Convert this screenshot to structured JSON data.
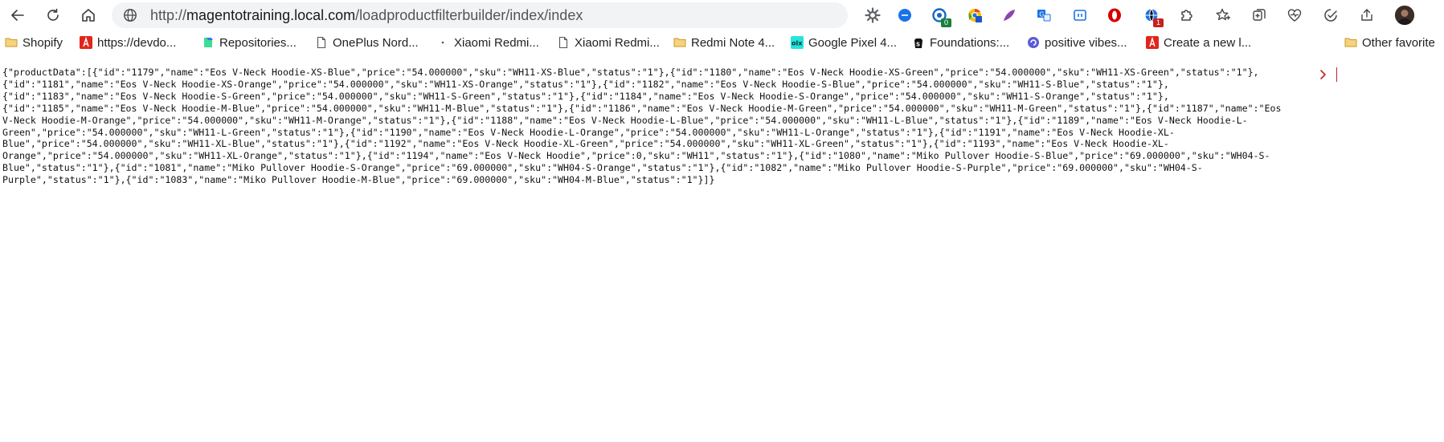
{
  "browser": {
    "url_scheme": "http://",
    "url_domain": "magentotraining.local.com",
    "url_path": "/loadproductfilterbuilder/index/index",
    "extensions": [
      {
        "name": "gear-extension-icon",
        "color": "#5f6368"
      },
      {
        "name": "blue-circle-extension-icon",
        "color": "#1a73e8"
      },
      {
        "name": "shield-extension-icon",
        "color": "#1565c0",
        "badge": "0",
        "badge_color": "#188038"
      },
      {
        "name": "chrome-extension-icon",
        "color": "#ea4335"
      },
      {
        "name": "feather-extension-icon",
        "color": "#8e44ad"
      },
      {
        "name": "translate-extension-icon",
        "color": "#1a73e8"
      },
      {
        "name": "bracket-extension-icon",
        "color": "#1a73e8"
      },
      {
        "name": "opera-extension-icon",
        "color": "#d50000"
      },
      {
        "name": "globe-extension-icon",
        "color": "#1a73e8",
        "badge": "1",
        "badge_color": "#c5221f"
      },
      {
        "name": "puzzle-extension-icon",
        "color": "#444"
      },
      {
        "name": "favorites-star-icon",
        "color": "#444"
      },
      {
        "name": "collections-icon",
        "color": "#444"
      },
      {
        "name": "heart-pulse-icon",
        "color": "#444"
      },
      {
        "name": "performance-icon",
        "color": "#444"
      },
      {
        "name": "share-icon",
        "color": "#444"
      }
    ]
  },
  "bookmarks": {
    "items": [
      {
        "label": "Shopify",
        "icon": "folder-icon"
      },
      {
        "label": "https://devdo...",
        "icon": "adobe-icon"
      },
      {
        "label": "Repositories...",
        "icon": "repo-icon"
      },
      {
        "label": "OnePlus Nord...",
        "icon": "page-icon"
      },
      {
        "label": "Xiaomi Redmi...",
        "icon": "dot-icon"
      },
      {
        "label": "Xiaomi Redmi...",
        "icon": "page-icon"
      },
      {
        "label": "Redmi Note 4...",
        "icon": "folder-icon"
      },
      {
        "label": "Google Pixel 4...",
        "icon": "olx-icon"
      },
      {
        "label": "Foundations:...",
        "icon": "shopify-icon"
      },
      {
        "label": "positive vibes...",
        "icon": "vibes-icon"
      },
      {
        "label": "Create a new l...",
        "icon": "adobe-icon"
      }
    ],
    "other_label": "Other favorite"
  },
  "page": {
    "lines": [
      "{\"productData\":[{\"id\":\"1179\",\"name\":\"Eos V-Neck Hoodie-XS-Blue\",\"price\":\"54.000000\",\"sku\":\"WH11-XS-Blue\",\"status\":\"1\"},{\"id\":\"1180\",\"name\":\"Eos V-Neck Hoodie-XS-Green\",\"price\":\"54.000000\",\"sku\":\"WH11-XS-Green\",\"status\":\"1\"},",
      "{\"id\":\"1181\",\"name\":\"Eos V-Neck Hoodie-XS-Orange\",\"price\":\"54.000000\",\"sku\":\"WH11-XS-Orange\",\"status\":\"1\"},{\"id\":\"1182\",\"name\":\"Eos V-Neck Hoodie-S-Blue\",\"price\":\"54.000000\",\"sku\":\"WH11-S-Blue\",\"status\":\"1\"},",
      "{\"id\":\"1183\",\"name\":\"Eos V-Neck Hoodie-S-Green\",\"price\":\"54.000000\",\"sku\":\"WH11-S-Green\",\"status\":\"1\"},{\"id\":\"1184\",\"name\":\"Eos V-Neck Hoodie-S-Orange\",\"price\":\"54.000000\",\"sku\":\"WH11-S-Orange\",\"status\":\"1\"},",
      "{\"id\":\"1185\",\"name\":\"Eos V-Neck Hoodie-M-Blue\",\"price\":\"54.000000\",\"sku\":\"WH11-M-Blue\",\"status\":\"1\"},{\"id\":\"1186\",\"name\":\"Eos V-Neck Hoodie-M-Green\",\"price\":\"54.000000\",\"sku\":\"WH11-M-Green\",\"status\":\"1\"},{\"id\":\"1187\",\"name\":\"Eos",
      "V-Neck Hoodie-M-Orange\",\"price\":\"54.000000\",\"sku\":\"WH11-M-Orange\",\"status\":\"1\"},{\"id\":\"1188\",\"name\":\"Eos V-Neck Hoodie-L-Blue\",\"price\":\"54.000000\",\"sku\":\"WH11-L-Blue\",\"status\":\"1\"},{\"id\":\"1189\",\"name\":\"Eos V-Neck Hoodie-L-",
      "Green\",\"price\":\"54.000000\",\"sku\":\"WH11-L-Green\",\"status\":\"1\"},{\"id\":\"1190\",\"name\":\"Eos V-Neck Hoodie-L-Orange\",\"price\":\"54.000000\",\"sku\":\"WH11-L-Orange\",\"status\":\"1\"},{\"id\":\"1191\",\"name\":\"Eos V-Neck Hoodie-XL-",
      "Blue\",\"price\":\"54.000000\",\"sku\":\"WH11-XL-Blue\",\"status\":\"1\"},{\"id\":\"1192\",\"name\":\"Eos V-Neck Hoodie-XL-Green\",\"price\":\"54.000000\",\"sku\":\"WH11-XL-Green\",\"status\":\"1\"},{\"id\":\"1193\",\"name\":\"Eos V-Neck Hoodie-XL-",
      "Orange\",\"price\":\"54.000000\",\"sku\":\"WH11-XL-Orange\",\"status\":\"1\"},{\"id\":\"1194\",\"name\":\"Eos V-Neck Hoodie\",\"price\":0,\"sku\":\"WH11\",\"status\":\"1\"},{\"id\":\"1080\",\"name\":\"Miko Pullover Hoodie-S-Blue\",\"price\":\"69.000000\",\"sku\":\"WH04-S-",
      "Blue\",\"status\":\"1\"},{\"id\":\"1081\",\"name\":\"Miko Pullover Hoodie-S-Orange\",\"price\":\"69.000000\",\"sku\":\"WH04-S-Orange\",\"status\":\"1\"},{\"id\":\"1082\",\"name\":\"Miko Pullover Hoodie-S-Purple\",\"price\":\"69.000000\",\"sku\":\"WH04-S-",
      "Purple\",\"status\":\"1\"},{\"id\":\"1083\",\"name\":\"Miko Pullover Hoodie-M-Blue\",\"price\":\"69.000000\",\"sku\":\"WH04-M-Blue\",\"status\":\"1\"}]}"
    ]
  }
}
